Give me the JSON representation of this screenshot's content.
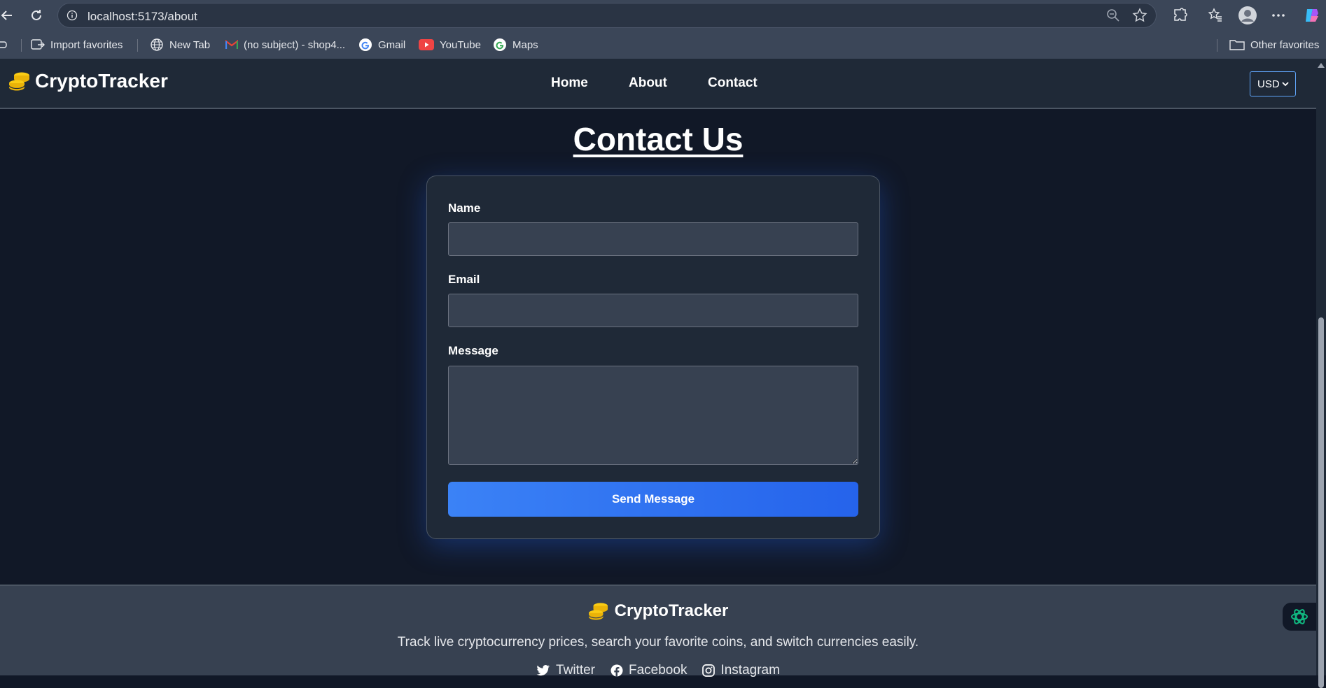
{
  "browser": {
    "url": "localhost:5173/about",
    "bookmarks": [
      {
        "label": "Import favorites",
        "icon": "import-icon"
      },
      {
        "label": "New Tab",
        "icon": "globe-icon"
      },
      {
        "label": "(no subject) - shop4...",
        "icon": "gmail-icon"
      },
      {
        "label": "Gmail",
        "icon": "google-icon"
      },
      {
        "label": "YouTube",
        "icon": "youtube-icon"
      },
      {
        "label": "Maps",
        "icon": "google-icon"
      }
    ],
    "other_favorites": "Other favorites"
  },
  "header": {
    "brand": "CryptoTracker",
    "nav": [
      "Home",
      "About",
      "Contact"
    ],
    "currency": "USD"
  },
  "main": {
    "title": "Contact Us",
    "form": {
      "name_label": "Name",
      "name_value": "",
      "email_label": "Email",
      "email_value": "",
      "message_label": "Message",
      "message_value": "",
      "submit_label": "Send Message"
    }
  },
  "footer": {
    "brand": "CryptoTracker",
    "tagline": "Track live cryptocurrency prices, search your favorite coins, and switch currencies easily.",
    "socials": [
      "Twitter",
      "Facebook",
      "Instagram"
    ]
  },
  "colors": {
    "accent": "#3b82f6",
    "coin": "#facc15",
    "background": "#111827",
    "header": "#1f2937",
    "footer": "#374151"
  }
}
